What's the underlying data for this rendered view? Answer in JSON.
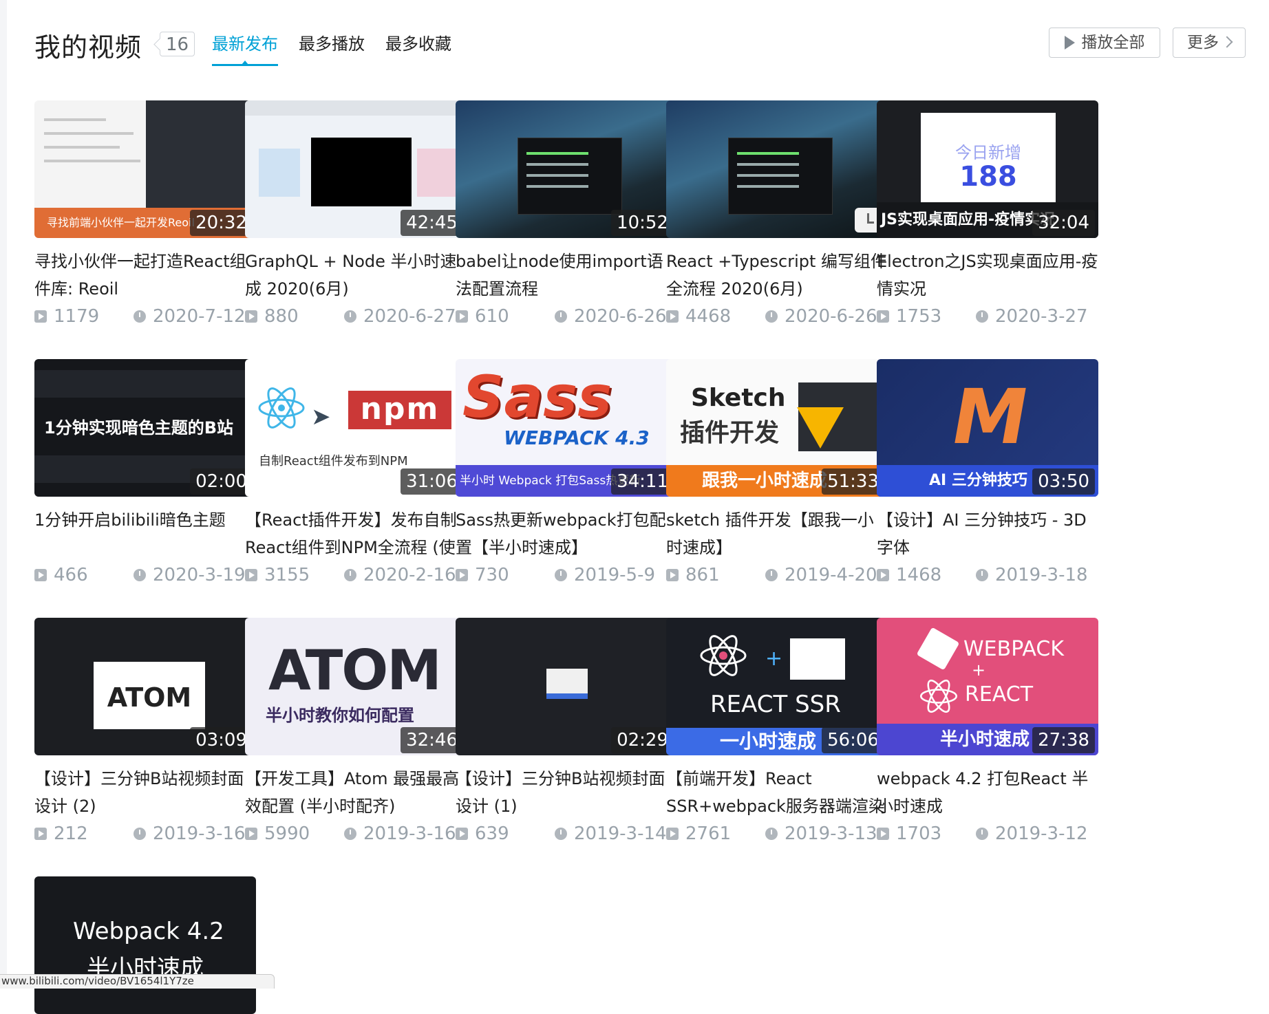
{
  "header": {
    "title": "我的视频",
    "count": "16",
    "tabs": [
      {
        "label": "最新发布",
        "active": true
      },
      {
        "label": "最多播放",
        "active": false
      },
      {
        "label": "最多收藏",
        "active": false
      }
    ],
    "play_all_label": "播放全部",
    "more_label": "更多"
  },
  "colors": {
    "accent": "#00a1d6",
    "meta": "#99a2aa"
  },
  "videos": [
    {
      "title": "寻找小伙伴一起打造React组件库: Reoil",
      "duration": "20:32",
      "plays": "1179",
      "date": "2020-7-12",
      "thumb_text": "寻找前端小伙伴一起开发Reoil"
    },
    {
      "title": "GraphQL + Node 半小时速成 2020(6月)",
      "duration": "42:45",
      "plays": "880",
      "date": "2020-6-27"
    },
    {
      "title": "babel让node使用import语法配置流程",
      "duration": "10:52",
      "plays": "610",
      "date": "2020-6-26"
    },
    {
      "title": "React +Typescript 编写组件全流程 2020(6月)",
      "duration": "",
      "plays": "4468",
      "date": "2020-6-26"
    },
    {
      "title": "Electron之JS实现桌面应用-疫情实况",
      "duration": "32:04",
      "plays": "1753",
      "date": "2020-3-27",
      "thumb_text1": "今日新增",
      "thumb_text2": "188",
      "thumb_text3": "JS实现桌面应用-疫情实况"
    },
    {
      "title": "1分钟开启bilibili暗色主题",
      "duration": "02:00",
      "plays": "466",
      "date": "2020-3-19",
      "thumb_text": "1分钟实现暗色主题的B站"
    },
    {
      "title": "【React插件开发】发布自制React组件到NPM全流程 (使",
      "duration": "31:06",
      "plays": "3155",
      "date": "2020-2-16",
      "thumb_text": "npm",
      "thumb_sub": "自制React组件发布到NPM"
    },
    {
      "title": "Sass热更新webpack打包配置【半小时速成】",
      "duration": "34:11",
      "plays": "730",
      "date": "2019-5-9",
      "thumb_text": "Sass",
      "thumb_sub": "WEBPACK 4.3",
      "thumb_band": "半小时 Webpack 打包Sass热更新"
    },
    {
      "title": "sketch 插件开发【跟我一小时速成】",
      "duration": "51:33",
      "plays": "861",
      "date": "2019-4-20",
      "thumb_text": "Sketch",
      "thumb_sub": "插件开发",
      "thumb_band": "跟我一小时速成"
    },
    {
      "title": "【设计】AI 三分钟技巧 - 3D 字体",
      "duration": "03:50",
      "plays": "1468",
      "date": "2019-3-18",
      "thumb_text": "M",
      "thumb_band": "AI 三分钟技巧"
    },
    {
      "title": "【设计】三分钟B站视频封面设计 (2)",
      "duration": "03:09",
      "plays": "212",
      "date": "2019-3-16",
      "thumb_text": "ATOM"
    },
    {
      "title": "【开发工具】Atom 最强最高效配置 (半小时配齐)",
      "duration": "32:46",
      "plays": "5990",
      "date": "2019-3-16",
      "thumb_text": "ATOM",
      "thumb_sub": "半小时教你如何配置"
    },
    {
      "title": "【设计】三分钟B站视频封面设计 (1)",
      "duration": "02:29",
      "plays": "639",
      "date": "2019-3-14"
    },
    {
      "title": "【前端开发】React SSR+webpack服务器端渲染",
      "duration": "56:06",
      "plays": "2761",
      "date": "2019-3-13",
      "thumb_text": "REACT SSR",
      "thumb_band": "一小时速成"
    },
    {
      "title": "webpack 4.2 打包React 半小时速成",
      "duration": "27:38",
      "plays": "1703",
      "date": "2019-3-12",
      "thumb_text1": "WEBPACK",
      "thumb_text2": "REACT",
      "thumb_band": "半小时速成"
    },
    {
      "title": "",
      "duration": "",
      "plays": "",
      "date": "",
      "thumb_text1": "Webpack 4.2",
      "thumb_text2": "半小时速成"
    }
  ],
  "statusbar": "www.bilibili.com/video/BV1654l1Y7ze"
}
